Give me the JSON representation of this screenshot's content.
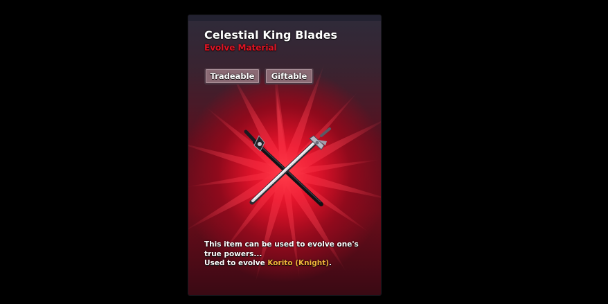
{
  "item": {
    "name": "Celestial King Blades",
    "category": "Evolve Material",
    "category_color": "#e01424",
    "tags": [
      "Tradeable",
      "Giftable"
    ],
    "icon": "crossed-swords-icon",
    "description": {
      "line1": "This item can be used to evolve one's",
      "line2": "true powers...",
      "line3_prefix": "Used to evolve ",
      "unit_name": "Korito (Knight)",
      "line3_suffix": "."
    },
    "highlight_color": "#f0b43a"
  }
}
